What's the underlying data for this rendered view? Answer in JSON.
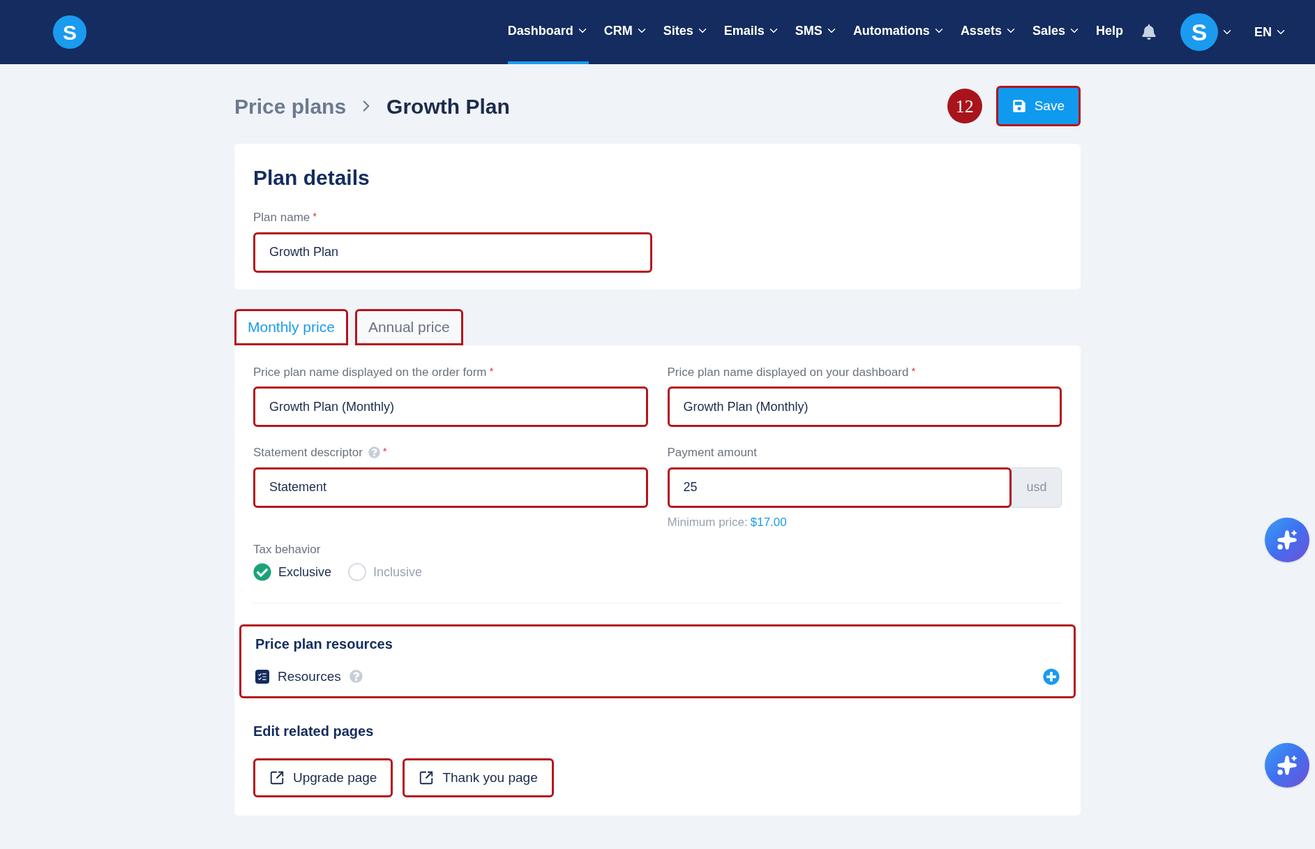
{
  "nav": {
    "logo_letter": "S",
    "items": [
      {
        "label": "Dashboard",
        "selected": true,
        "has_menu": true
      },
      {
        "label": "CRM",
        "selected": false,
        "has_menu": true
      },
      {
        "label": "Sites",
        "selected": false,
        "has_menu": true
      },
      {
        "label": "Emails",
        "selected": false,
        "has_menu": true
      },
      {
        "label": "SMS",
        "selected": false,
        "has_menu": true
      },
      {
        "label": "Automations",
        "selected": false,
        "has_menu": true
      },
      {
        "label": "Assets",
        "selected": false,
        "has_menu": true
      },
      {
        "label": "Sales",
        "selected": false,
        "has_menu": true
      },
      {
        "label": "Help",
        "selected": false,
        "has_menu": false
      }
    ],
    "avatar_letter": "S",
    "language": "EN"
  },
  "breadcrumb": {
    "parent": "Price plans",
    "current": "Growth Plan"
  },
  "step_badge": "12",
  "save_button": {
    "label": "Save",
    "highlighted": true
  },
  "plan_details": {
    "title": "Plan details",
    "plan_name": {
      "label": "Plan name",
      "mark": "*",
      "value": "Growth Plan",
      "highlighted": true
    }
  },
  "price_tabs": [
    {
      "label": "Monthly price",
      "selected": true,
      "highlighted": true
    },
    {
      "label": "Annual price",
      "selected": false,
      "highlighted": true
    }
  ],
  "price_form": {
    "order_form_name": {
      "label": "Price plan name displayed on the order form",
      "mark": "*",
      "value": "Growth Plan (Monthly)",
      "highlighted": true
    },
    "dashboard_name": {
      "label": "Price plan name displayed on your dashboard",
      "mark": "*",
      "value": "Growth Plan (Monthly)",
      "highlighted": true
    },
    "statement_descriptor": {
      "label": "Statement descriptor",
      "help": true,
      "mark": "*",
      "value": "Statement",
      "highlighted": true
    },
    "payment_amount": {
      "label": "Payment amount",
      "value": "25",
      "unit": "usd",
      "hint_label": "Minimum price:",
      "hint_value": "$17.00",
      "highlighted": true
    },
    "tax_behavior": {
      "label": "Tax behavior",
      "options": [
        {
          "label": "Exclusive",
          "selected": true
        },
        {
          "label": "Inclusive",
          "selected": false
        }
      ]
    }
  },
  "resources": {
    "title": "Price plan resources",
    "item": "Resources",
    "help": true,
    "highlighted": true
  },
  "related_pages": {
    "title": "Edit related pages",
    "buttons": [
      {
        "label": "Upgrade page",
        "highlighted": true
      },
      {
        "label": "Thank you page",
        "highlighted": true
      }
    ]
  }
}
